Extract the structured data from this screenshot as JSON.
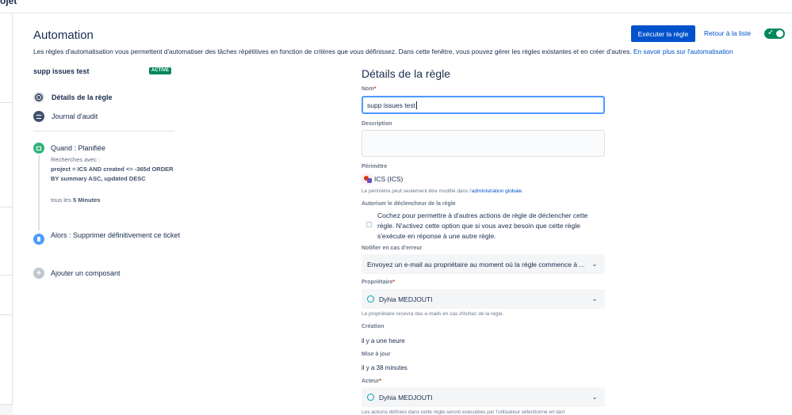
{
  "topbar": {
    "project_fragment": "ojet"
  },
  "header": {
    "title": "Automation",
    "description": "Les règles d'automatisation vous permettent d'automatiser des tâches répétitives en fonction de critères que vous définissez. Dans cette fenêtre, vous pouvez gérer les règles existantes et en créer d'autres.",
    "learn_more": "En savoir plus sur l'automatisation",
    "run_button": "Exécuter la règle",
    "back_link": "Retour à la liste",
    "toggle_on": true
  },
  "rule": {
    "name": "supp issues test",
    "status": "ACTIVÉ"
  },
  "nav": {
    "details": "Détails de la règle",
    "audit": "Journal d'audit"
  },
  "steps": {
    "when_title": "Quand : Planifiée",
    "when_sub": "Recherches avec :",
    "when_query": "project = ICS AND created <= -365d ORDER BY summary ASC, updated DESC",
    "when_every_prefix": "tous les",
    "when_every_value": "5 Minutes",
    "then_title": "Alors : Supprimer définitivement ce ticket",
    "add": "Ajouter un composant"
  },
  "details": {
    "title": "Détails de la règle",
    "name_label": "Nom",
    "name_value": "supp issues test",
    "description_label": "Description",
    "description_value": "",
    "scope_label": "Périmètre",
    "scope_value": "ICS (ICS)",
    "scope_hint_prefix": "Le périmètre peut seulement être modifié dans l'",
    "scope_hint_link": "administration globale",
    "scope_hint_suffix": ".",
    "allow_trigger_label": "Autoriser le déclencheur de la règle",
    "allow_trigger_text": "Cochez pour permettre à d'autres actions de règle de déclencher cette règle. N'activez cette option que si vous avez besoin que cette règle s'exécute en réponse à une autre règle.",
    "allow_trigger_checked": false,
    "notify_label": "Notifier en cas d'erreur",
    "notify_value": "Envoyez un e-mail au propriétaire au moment où la règle commence à ...",
    "owner_label": "Propriétaire",
    "owner_value": "Dyhia MEDJOUTI",
    "owner_hint": "Le propriétaire recevra des e-mails en cas d'échec de la règle.",
    "created_label": "Création",
    "created_value": "il y a une heure",
    "updated_label": "Mise à jour",
    "updated_value": "il y a 38 minutes",
    "actor_label": "Acteur",
    "actor_value": "Dyhia MEDJOUTI",
    "actor_hint": "Les actions définies dans cette règle seront exécutées par l'utilisateur sélectionné en tant"
  },
  "colors": {
    "primary": "#0052cc",
    "success": "#00875a",
    "text": "#172b4d",
    "focus": "#4c9aff"
  }
}
